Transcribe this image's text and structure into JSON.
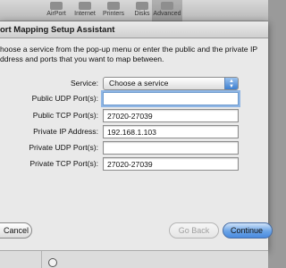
{
  "toolbar": {
    "items": [
      {
        "label": "AirPort",
        "icon": "airport-icon"
      },
      {
        "label": "Internet",
        "icon": "internet-icon"
      },
      {
        "label": "Printers",
        "icon": "printer-icon"
      },
      {
        "label": "Disks",
        "icon": "disk-icon"
      },
      {
        "label": "Advanced",
        "icon": "advanced-icon"
      }
    ],
    "active": "Advanced"
  },
  "sheet": {
    "title": "ort Mapping Setup Assistant",
    "description_line1": "hoose a service from the pop-up menu or enter the public and the private IP",
    "description_line2": "ddress and ports that you want to map between."
  },
  "form": {
    "service": {
      "label": "Service:",
      "value": "Choose a service",
      "arrow_icon": "updown-arrows-icon"
    },
    "public_udp": {
      "label": "Public UDP Port(s):",
      "value": ""
    },
    "public_tcp": {
      "label": "Public TCP Port(s):",
      "value": "27020-27039"
    },
    "private_ip": {
      "label": "Private IP Address:",
      "value": "192.168.1.103"
    },
    "private_udp": {
      "label": "Private UDP Port(s):",
      "value": ""
    },
    "private_tcp": {
      "label": "Private TCP Port(s):",
      "value": "27020-27039"
    }
  },
  "buttons": {
    "cancel": "Cancel",
    "back": "Go Back",
    "continue": "Continue"
  },
  "colors": {
    "accent": "#4a8be0",
    "focus_ring": "#8fb6e5"
  }
}
